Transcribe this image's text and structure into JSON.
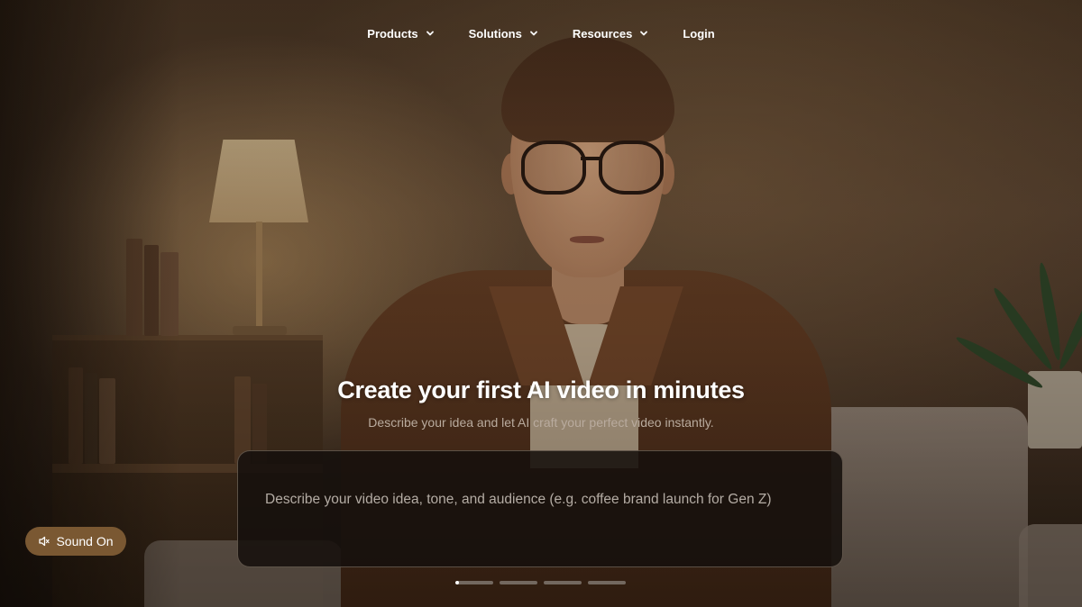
{
  "nav": {
    "items": [
      {
        "label": "Products",
        "has_dropdown": true
      },
      {
        "label": "Solutions",
        "has_dropdown": true
      },
      {
        "label": "Resources",
        "has_dropdown": true
      },
      {
        "label": "Login",
        "has_dropdown": false
      }
    ]
  },
  "hero": {
    "title": "Create your first AI video in minutes",
    "subtitle": "Describe your idea and let AI craft your perfect video instantly."
  },
  "prompt": {
    "value": "",
    "placeholder": "Describe your video idea, tone, and audience (e.g. coffee brand launch for Gen Z)"
  },
  "carousel": {
    "slide_count": 4,
    "active_index": 0,
    "active_progress": 0.1
  },
  "sound_button": {
    "label": "Sound On",
    "icon": "speaker-icon"
  },
  "colors": {
    "sound_button_bg": "#7a5832",
    "prompt_border": "#968778",
    "text_primary": "#ffffff",
    "text_muted": "#b9ab9e"
  }
}
